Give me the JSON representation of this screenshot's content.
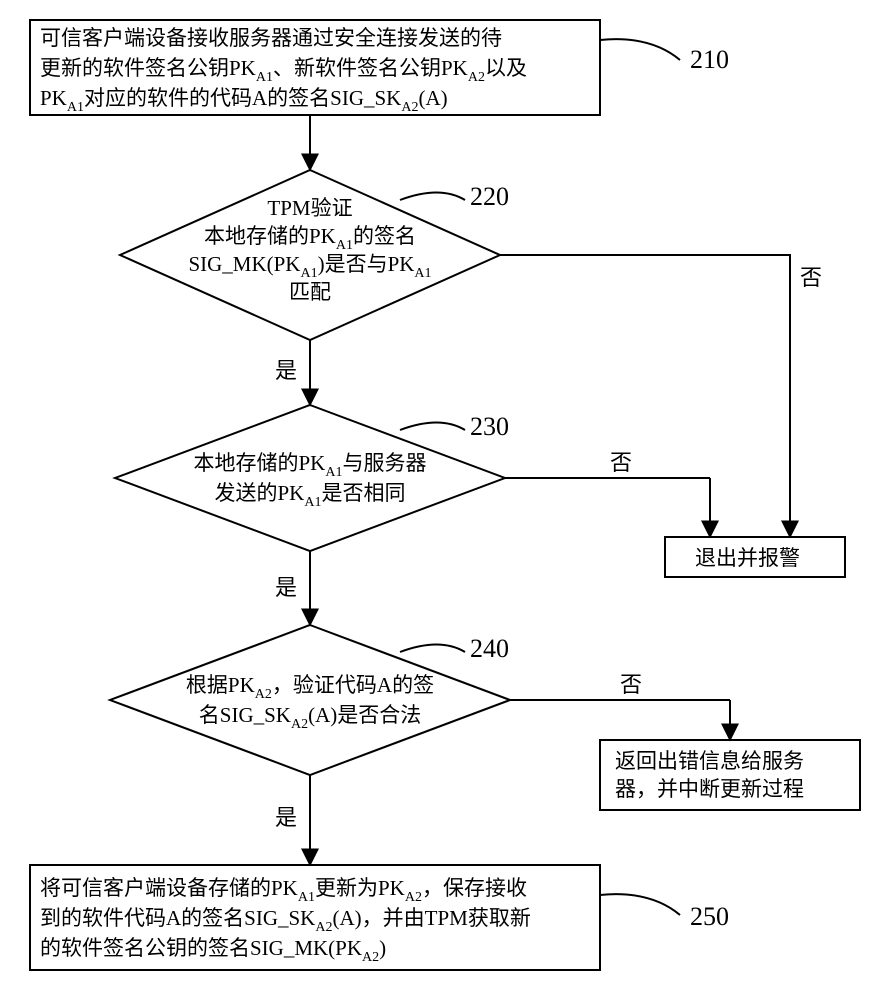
{
  "flowchart": {
    "nodes": {
      "n210": {
        "label": "210",
        "line1_a": "可信客户端设备接收服务器通过安全连接发送的待",
        "line2_a": "更新的软件签名公钥PK",
        "line2_sub1": "A1",
        "line2_b": "、新软件签名公钥PK",
        "line2_sub2": "A2",
        "line2_c": "以及",
        "line3_a": "PK",
        "line3_sub1": "A1",
        "line3_b": "对应的软件的代码A的签名SIG_SK",
        "line3_sub2": "A2",
        "line3_c": "(A)"
      },
      "n220": {
        "label": "220",
        "line1": "TPM验证",
        "line2_a": "本地存储的PK",
        "line2_sub": "A1",
        "line2_b": "的签名",
        "line3_a": "SIG_MK(PK",
        "line3_sub": "A1",
        "line3_b": ")是否与PK",
        "line3_sub2": "A1",
        "line4": "匹配"
      },
      "n230": {
        "label": "230",
        "line1_a": "本地存储的PK",
        "line1_sub": "A1",
        "line1_b": "与服务器",
        "line2_a": "发送的PK",
        "line2_sub": "A1",
        "line2_b": "是否相同"
      },
      "n240": {
        "label": "240",
        "line1_a": "根据PK",
        "line1_sub": "A2",
        "line1_b": "，验证代码A的签",
        "line2_a": "名SIG_SK",
        "line2_sub": "A2",
        "line2_b": "(A)是否合法"
      },
      "n250": {
        "label": "250",
        "line1_a": "将可信客户端设备存储的PK",
        "line1_sub1": "A1",
        "line1_b": "更新为PK",
        "line1_sub2": "A2",
        "line1_c": "，保存接收",
        "line2_a": "到的软件代码A的签名SIG_SK",
        "line2_sub": "A2",
        "line2_b": "(A)，并由TPM获取新",
        "line3_a": "的软件签名公钥的签名SIG_MK(PK",
        "line3_sub": "A2",
        "line3_b": ")"
      },
      "alarm": {
        "text": "退出并报警"
      },
      "error": {
        "line1": "返回出错信息给服务",
        "line2": "器，并中断更新过程"
      }
    },
    "edges": {
      "yes": "是",
      "no": "否"
    }
  }
}
